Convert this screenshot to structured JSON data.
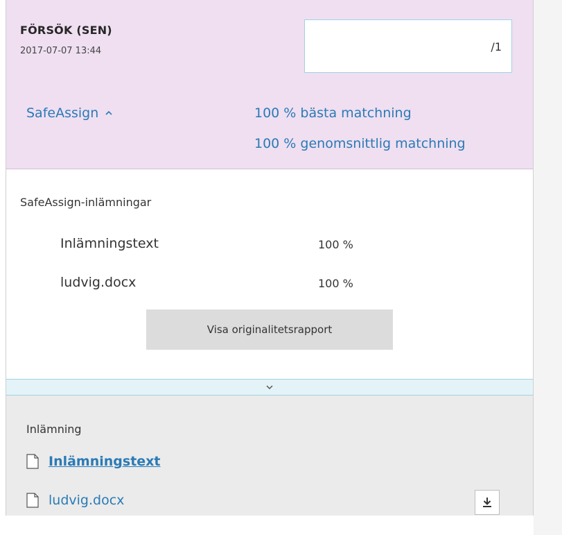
{
  "attempt": {
    "title": "FÖRSÖK (SEN)",
    "date": "2017-07-07 13:44",
    "grade_value": "",
    "grade_total": "/1"
  },
  "safeassign": {
    "toggle_label": "SafeAssign",
    "best_match": "100 % bästa matchning",
    "average_match": "100 % genomsnittlig matchning",
    "section_heading": "SafeAssign-inlämningar",
    "rows": [
      {
        "name": "Inlämningstext",
        "value": "100 %"
      },
      {
        "name": "ludvig.docx",
        "value": "100 %"
      }
    ],
    "report_button": "Visa originalitetsrapport"
  },
  "submission": {
    "heading": "Inlämning",
    "files": [
      {
        "name": "Inlämningstext",
        "icon": "document-icon"
      },
      {
        "name": "ludvig.docx",
        "icon": "document-icon"
      }
    ],
    "download_icon": "download-icon"
  },
  "colors": {
    "header_bg": "#efdff1",
    "link": "#2a7ab5",
    "accent_border": "#9fd3e3",
    "submission_bg": "#ebebeb",
    "button_bg": "#dcdcdc"
  }
}
